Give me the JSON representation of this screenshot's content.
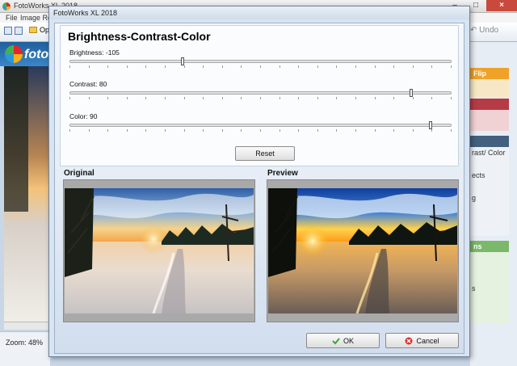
{
  "app": {
    "title": "FotoWorks XL 2018",
    "menu": [
      "File",
      "Image Rota"
    ],
    "toolbar": {
      "open_label": "Ope",
      "undo_label": "Undo"
    },
    "brand": "foto",
    "zoom_label": "Zoom: 48%",
    "right_panels": [
      {
        "header": "Flip",
        "color": "#f0a228",
        "items": []
      },
      {
        "header": "",
        "color": "#b53b46",
        "items": []
      },
      {
        "header": "",
        "color": "#44607f",
        "items": [
          "rast/ Color",
          "ects",
          "g"
        ]
      },
      {
        "header": "ns",
        "color": "#7bb86a",
        "items": [
          "s"
        ]
      }
    ]
  },
  "dialog": {
    "title": "FotoWorks XL 2018",
    "tool_title": "Brightness-Contrast-Color",
    "sliders": [
      {
        "label": "Brightness: -105",
        "value": -105,
        "min": -255,
        "max": 255
      },
      {
        "label": "Contrast: 80",
        "value": 80,
        "min": -100,
        "max": 100
      },
      {
        "label": "Color: 90",
        "value": 90,
        "min": -100,
        "max": 100
      }
    ],
    "reset_label": "Reset",
    "original_label": "Original",
    "preview_label": "Preview",
    "ok_label": "OK",
    "cancel_label": "Cancel"
  },
  "colors": {
    "accent_blue": "#2b5f9e",
    "ok_icon": "#3aa53a",
    "cancel_icon": "#d8342c"
  }
}
